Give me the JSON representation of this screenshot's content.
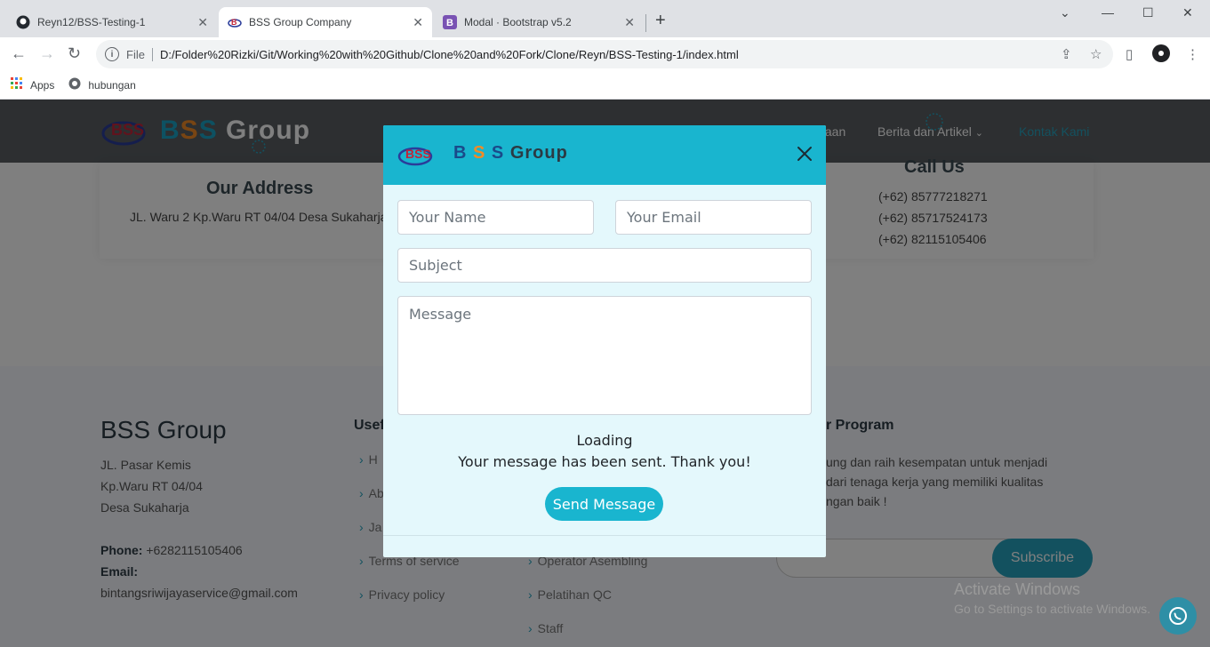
{
  "browser": {
    "tabs": [
      {
        "title": "Reyn12/BSS-Testing-1",
        "icon": "github-icon"
      },
      {
        "title": "BSS Group Company",
        "icon": "bss-logo-icon"
      },
      {
        "title": "Modal · Bootstrap v5.2",
        "icon": "bootstrap-icon"
      }
    ],
    "address_scheme": "File",
    "address_url": "D:/Folder%20Rizki/Git/Working%20with%20Github/Clone%20and%20Fork/Clone/Reyn/BSS-Testing-1/index.html",
    "bookmarks": [
      {
        "label": "Apps",
        "icon": "apps-grid-icon"
      },
      {
        "label": "hubungan",
        "icon": "globe-icon"
      }
    ]
  },
  "site": {
    "logo_letters": [
      "B",
      "S",
      "S"
    ],
    "logo_word": "Group",
    "logo_colors": [
      "#1aa3c4",
      "#f28b26",
      "#1aa3c4"
    ],
    "nav": [
      {
        "label": "taan"
      },
      {
        "label": "Berita dan Artikel"
      },
      {
        "label": "Kontak Kami"
      }
    ],
    "address_title": "Our Address",
    "address_text": "JL. Waru 2 Kp.Waru RT 04/04 Desa Sukaharja",
    "call_title": "Call Us",
    "phones": [
      "(+62) 85777218271",
      "(+62) 85717524173",
      "(+62) 82115105406"
    ]
  },
  "footer": {
    "brand": "BSS Group",
    "address_lines": [
      "JL. Pasar Kemis",
      "Kp.Waru RT 04/04",
      "Desa Sukaharja"
    ],
    "phone_label": "Phone:",
    "phone_value": "+6282115105406",
    "email_label": "Email:",
    "email_value": "bintangsriwijayaservice@gmail.com",
    "useful_heading": "Usef",
    "useful_links": [
      "H",
      "Ab",
      "Ja",
      "Terms of service",
      "Privacy policy"
    ],
    "program_links": [
      "Operator Asembling",
      "Pelatihan QC",
      "Staff"
    ],
    "newsletter_heading": "r Program",
    "newsletter_text": [
      "ung dan raih kesempatan untuk menjadi",
      "dari tenaga kerja yang memiliki kualitas",
      "ngan baik !"
    ],
    "subscribe_label": "Subscribe"
  },
  "os": {
    "activate_title": "Activate Windows",
    "activate_sub": "Go to Settings to activate Windows."
  },
  "modal": {
    "logo_letters": [
      "B",
      "S",
      "S"
    ],
    "logo_word": "Group",
    "name_placeholder": "Your Name",
    "email_placeholder": "Your Email",
    "subject_placeholder": "Subject",
    "message_placeholder": "Message",
    "loading_text": "Loading",
    "sent_text": "Your message has been sent. Thank you!",
    "send_label": "Send Message"
  }
}
